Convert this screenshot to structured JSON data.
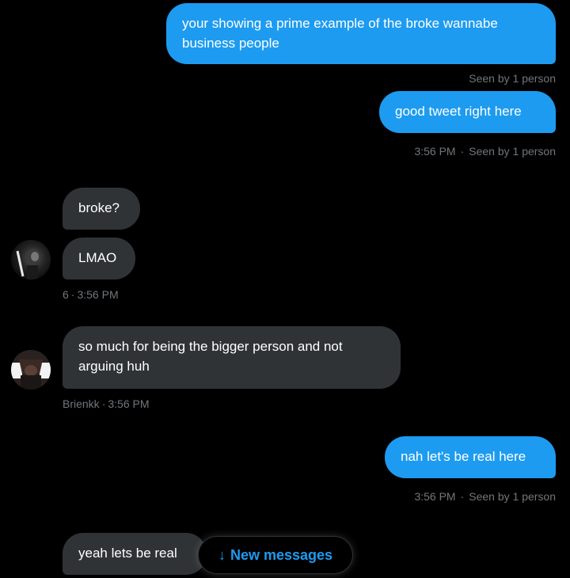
{
  "messages": [
    {
      "text": "your showing a prime example of the broke wannabe business people"
    },
    {
      "text": "good tweet right here"
    },
    {
      "text": "broke?"
    },
    {
      "text": "LMAO"
    },
    {
      "text": "so much for being the bigger person and not arguing huh"
    },
    {
      "text": "nah let's be real here"
    },
    {
      "text": "yeah lets be real"
    }
  ],
  "meta": {
    "m1_seen": "Seen by 1 person",
    "m2_time": "3:56 PM",
    "m2_seen": "Seen by 1 person",
    "m4_sender": "6",
    "m4_time": "3:56 PM",
    "m5_sender": "Brienkk",
    "m5_time": "3:56 PM",
    "m6_time": "3:56 PM",
    "m6_seen": "Seen by 1 person",
    "dot": "·"
  },
  "new_messages_button": {
    "arrow": "↓",
    "label": "New messages"
  },
  "colors": {
    "outgoing_bubble": "#1d9bf0",
    "incoming_bubble": "#2f3336",
    "meta_text": "#71767b",
    "background": "#000000"
  },
  "icons": [
    "avatar-user-6",
    "avatar-user-brienkk",
    "arrow-down-icon"
  ]
}
